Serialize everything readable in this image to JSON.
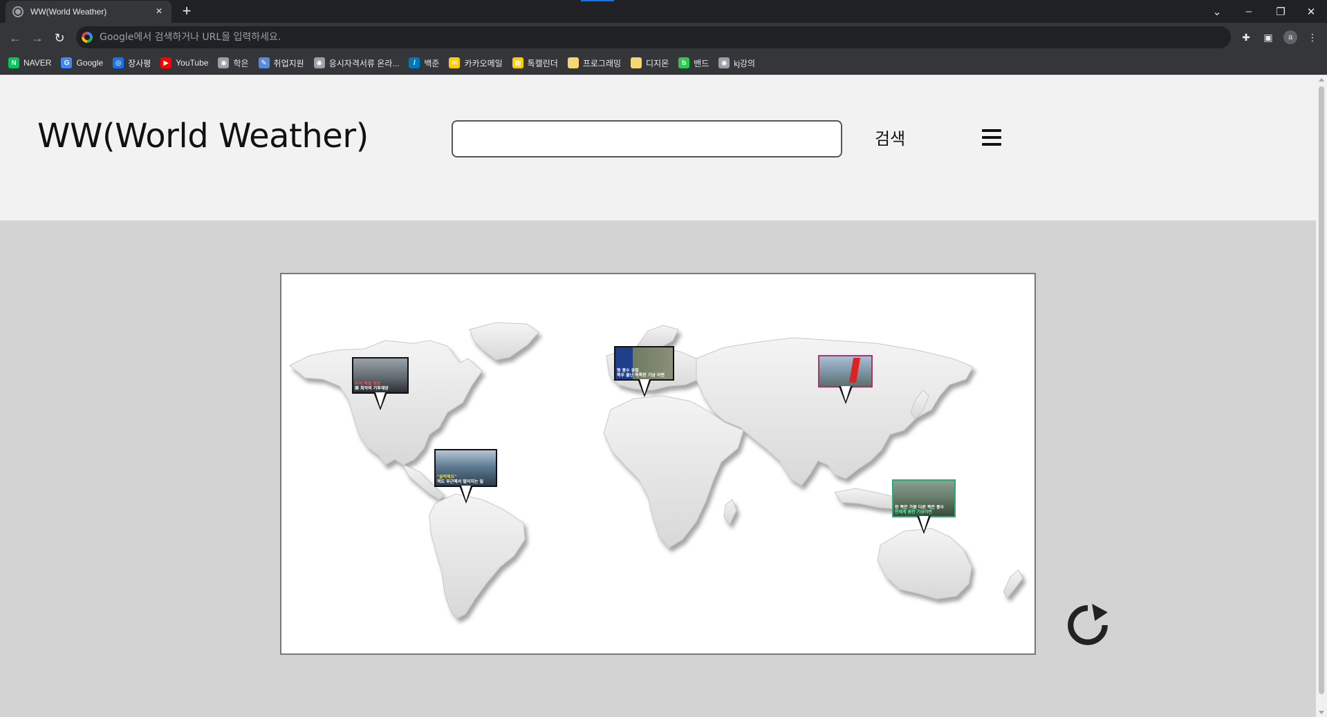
{
  "browser": {
    "tab_title": "WW(World Weather)",
    "new_tab_label": "+",
    "address_placeholder": "Google에서 검색하거나 URL을 입력하세요.",
    "profile_initial": "a",
    "bookmarks": [
      {
        "label": "NAVER",
        "icon": "naver-icon",
        "color": "#03c75a",
        "glyph": "N"
      },
      {
        "label": "Google",
        "icon": "google-icon",
        "color": "#4285f4",
        "glyph": "G"
      },
      {
        "label": "장사평",
        "icon": "globe-icon",
        "color": "#1a73e8",
        "glyph": "◎"
      },
      {
        "label": "YouTube",
        "icon": "youtube-icon",
        "color": "#ff0000",
        "glyph": "▶"
      },
      {
        "label": "학은",
        "icon": "globe-icon",
        "color": "#9aa0a6",
        "glyph": "◉"
      },
      {
        "label": "취업지원",
        "icon": "job-icon",
        "color": "#5b8bd6",
        "glyph": "✎"
      },
      {
        "label": "응시자격서류 온라...",
        "icon": "globe-icon",
        "color": "#9aa0a6",
        "glyph": "◉"
      },
      {
        "label": "백준",
        "icon": "baekjoon-icon",
        "color": "#0076c0",
        "glyph": "/"
      },
      {
        "label": "카카오메일",
        "icon": "kakao-mail-icon",
        "color": "#ffcd00",
        "glyph": "✉"
      },
      {
        "label": "톡캘린더",
        "icon": "kakao-calendar-icon",
        "color": "#ffcd00",
        "glyph": "▦"
      },
      {
        "label": "프로그래밍",
        "icon": "folder-icon",
        "color": "#f7d774",
        "glyph": ""
      },
      {
        "label": "디지몬",
        "icon": "folder-icon",
        "color": "#f7d774",
        "glyph": ""
      },
      {
        "label": "밴드",
        "icon": "band-icon",
        "color": "#2dc84d",
        "glyph": "b"
      },
      {
        "label": "kj강의",
        "icon": "globe-icon",
        "color": "#9aa0a6",
        "glyph": "◉"
      }
    ]
  },
  "page": {
    "title": "WW(World Weather)",
    "search_button": "검색",
    "menu_icon": "hamburger-menu-icon",
    "refresh_icon": "refresh-icon"
  },
  "map": {
    "pins": [
      {
        "id": "north-america",
        "caption_line1": "미국 폭설 경보",
        "caption_line2": "美 최악의 기후재앙",
        "accent": "#ff4040",
        "bg": "#6e7378"
      },
      {
        "id": "europe",
        "caption_line1": "형 홍수 유럽 ",
        "caption_line2": "폭우 물난 독특한 기상 이변",
        "accent": "#ffffff",
        "bg": "#2c4a8a"
      },
      {
        "id": "east-asia",
        "caption_line1": "",
        "caption_line2": "",
        "accent": "#c04080",
        "bg": "#8aa0b0"
      },
      {
        "id": "south-america",
        "caption_line1": "\"끓력해요\"",
        "caption_line2": "적도 부근에서 벌어지는 일",
        "accent": "#ffd700",
        "bg": "#3a4a5e"
      },
      {
        "id": "australia",
        "caption_line1": "한 쪽은 가뭄 다른 쪽은 홍수",
        "caption_line2": "전세계 몸찬 기상이변",
        "accent": "#3fff9f",
        "bg": "#4a6a5a"
      }
    ]
  }
}
